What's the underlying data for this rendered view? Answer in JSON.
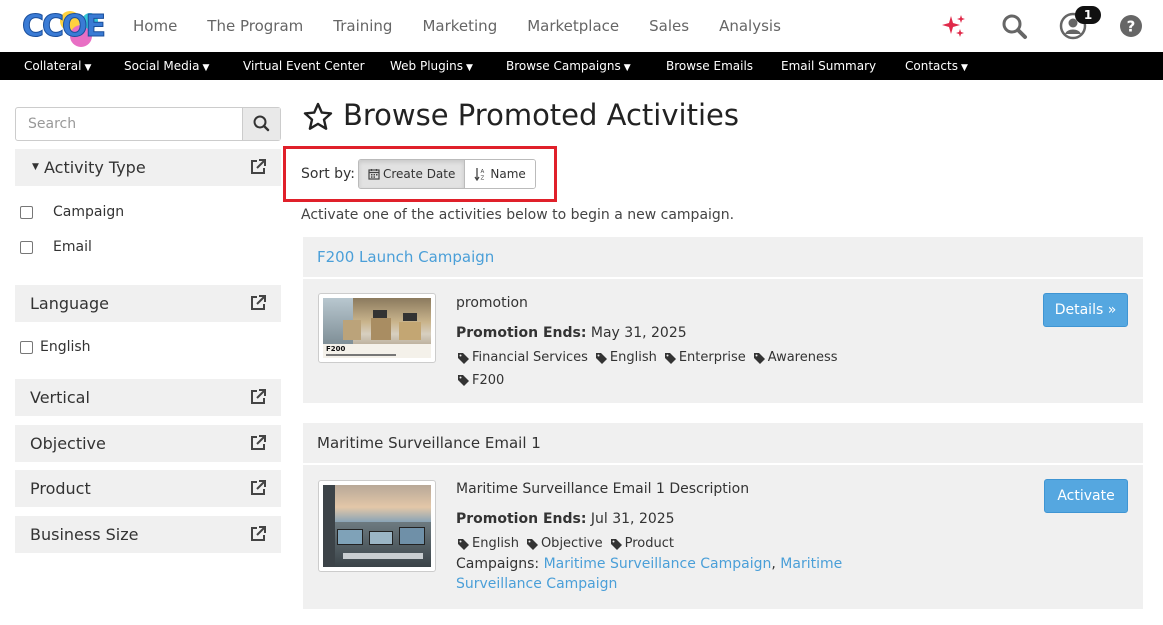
{
  "header": {
    "logo_text": "CCOE",
    "nav": [
      "Home",
      "The Program",
      "Training",
      "Marketing",
      "Marketplace",
      "Sales",
      "Analysis"
    ],
    "notification_count": "1",
    "icons": [
      "sparkles-icon",
      "search-icon",
      "user-icon",
      "help-icon"
    ]
  },
  "subnav": {
    "items": [
      {
        "label": "Collateral",
        "dropdown": true
      },
      {
        "label": "Social Media",
        "dropdown": true
      },
      {
        "label": "Virtual Event Center",
        "dropdown": false
      },
      {
        "label": "Web Plugins",
        "dropdown": true
      },
      {
        "label": "Browse Campaigns",
        "dropdown": true
      },
      {
        "label": "Browse Emails",
        "dropdown": false
      },
      {
        "label": "Email Summary",
        "dropdown": false
      },
      {
        "label": "Contacts",
        "dropdown": true
      }
    ]
  },
  "sidebar": {
    "search_placeholder": "Search",
    "facets": {
      "activity_type": {
        "label": "Activity Type",
        "options": [
          "Campaign",
          "Email"
        ]
      },
      "language": {
        "label": "Language",
        "options": [
          "English"
        ]
      },
      "vertical": {
        "label": "Vertical"
      },
      "objective": {
        "label": "Objective"
      },
      "product": {
        "label": "Product"
      },
      "business_size": {
        "label": "Business Size"
      }
    }
  },
  "main": {
    "title": "Browse Promoted Activities",
    "sort_label": "Sort by:",
    "sort_options": [
      "Create Date",
      "Name"
    ],
    "intro": "Activate one of the activities below to begin a new campaign.",
    "activities": [
      {
        "title": "F200 Launch Campaign",
        "name": "promotion",
        "ends_label": "Promotion Ends:",
        "ends_date": "May 31, 2025",
        "tags": [
          "Financial Services",
          "English",
          "Enterprise",
          "Awareness",
          "F200"
        ],
        "button": "Details »",
        "thumb_caption": "F200"
      },
      {
        "title": "Maritime Surveillance Email 1",
        "name": "Maritime Surveillance Email 1 Description",
        "ends_label": "Promotion Ends:",
        "ends_date": "Jul 31, 2025",
        "tags": [
          "English",
          "Objective",
          "Product"
        ],
        "campaigns_label": "Campaigns:",
        "campaign_1": "Maritime Surveillance Campaign",
        "campaign_2": "Maritime Surveillance Campaign",
        "button": "Activate"
      }
    ]
  },
  "colors": {
    "accent": "#4a9fd8",
    "button": "#55a7e0",
    "highlight": "#e0202a",
    "subnav_bg": "#000000"
  }
}
